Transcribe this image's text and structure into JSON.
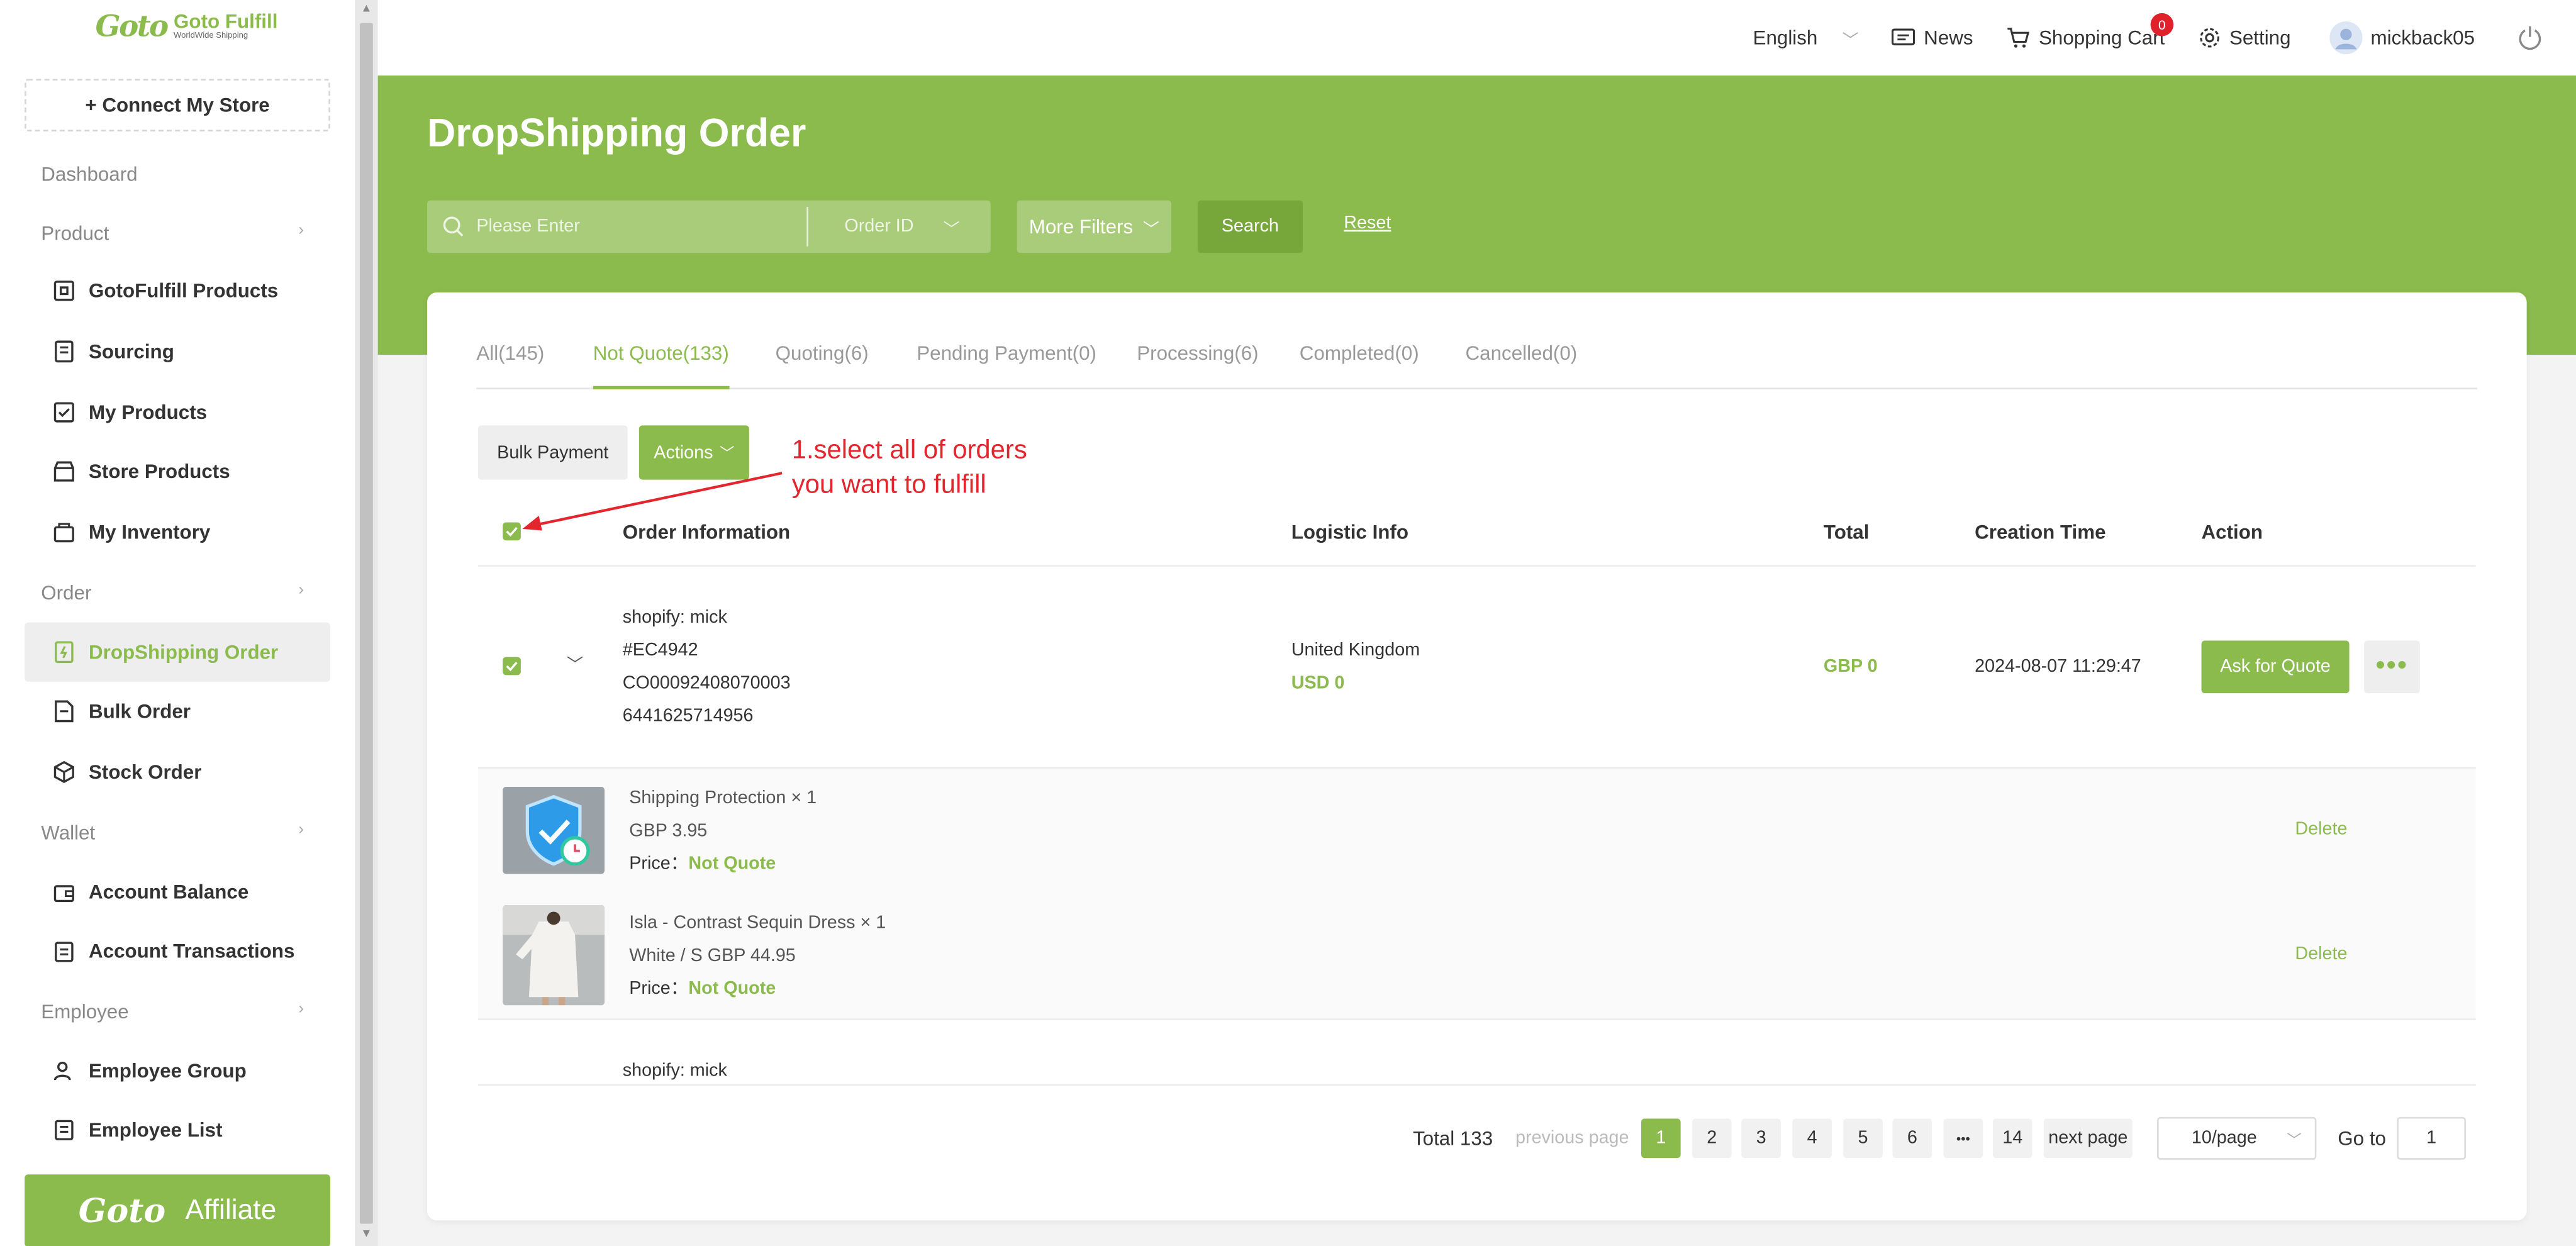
{
  "sidebar": {
    "logo_name": "Goto Fulfill",
    "logo_tagline": "WorldWide Shipping",
    "logo_mark": "Goto",
    "connect_label": "+ Connect My Store",
    "dashboard": "Dashboard",
    "sections": {
      "product": "Product",
      "order": "Order",
      "wallet": "Wallet",
      "employee": "Employee"
    },
    "items": {
      "gotofulfill_products": "GotoFulfill Products",
      "sourcing": "Sourcing",
      "my_products": "My Products",
      "store_products": "Store Products",
      "my_inventory": "My Inventory",
      "dropshipping_order": "DropShipping Order",
      "bulk_order": "Bulk Order",
      "stock_order": "Stock Order",
      "account_balance": "Account Balance",
      "account_transactions": "Account Transactions",
      "employee_group": "Employee Group",
      "employee_list": "Employee List"
    },
    "affiliate_label": "Affiliate",
    "accent_color": "#8bbb4c"
  },
  "topbar": {
    "language": "English",
    "news": "News",
    "cart": "Shopping Cart",
    "cart_count": "0",
    "setting": "Setting",
    "username": "mickback05"
  },
  "page": {
    "title": "DropShipping Order",
    "search_placeholder": "Please Enter",
    "search_type": "Order ID",
    "more_filters": "More Filters",
    "search_btn": "Search",
    "reset": "Reset"
  },
  "tabs": [
    "All(145)",
    "Not Quote(133)",
    "Quoting(6)",
    "Pending Payment(0)",
    "Processing(6)",
    "Completed(0)",
    "Cancelled(0)"
  ],
  "toolbar": {
    "bulk_payment": "Bulk Payment",
    "actions": "Actions"
  },
  "annotation": {
    "line1": "1.select all of orders",
    "line2": "you want to fulfill"
  },
  "table": {
    "headers": {
      "order_info": "Order Information",
      "logistic": "Logistic Info",
      "total": "Total",
      "creation": "Creation Time",
      "action": "Action"
    },
    "order": {
      "store": "shopify: mick",
      "order_no": "#EC4942",
      "co_no": "CO00092408070003",
      "ext_id": "6441625714956",
      "country": "United Kingdom",
      "shipping": "USD 0",
      "total": "GBP 0",
      "created": "2024-08-07 11:29:47",
      "ask_quote": "Ask for Quote"
    },
    "products": [
      {
        "name": "Shipping Protection × 1",
        "variant": "GBP 3.95",
        "price_label": "Price：",
        "price_value": "Not Quote",
        "delete": "Delete"
      },
      {
        "name": "Isla - Contrast Sequin Dress × 1",
        "variant": "White / S GBP 44.95",
        "price_label": "Price：",
        "price_value": "Not Quote",
        "delete": "Delete"
      }
    ],
    "next_store": "shopify: mick"
  },
  "pagination": {
    "total": "Total 133",
    "prev": "previous page",
    "pages": [
      "1",
      "2",
      "3",
      "4",
      "5",
      "6",
      "•••",
      "14"
    ],
    "next": "next page",
    "page_size": "10/page",
    "goto_label": "Go to",
    "goto_value": "1"
  }
}
